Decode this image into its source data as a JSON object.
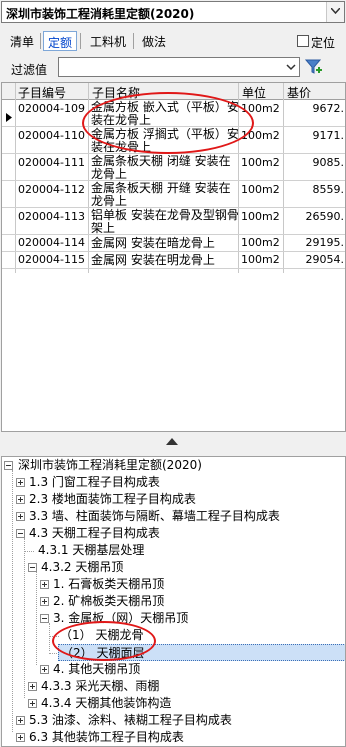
{
  "selector": {
    "value": "深圳市装饰工程消耗里定额(2020)"
  },
  "tabs": {
    "list": "清单",
    "quota": "定额",
    "labor": "工料机",
    "method": "做法",
    "locate": "定位"
  },
  "filter": {
    "label": "过滤值",
    "value": ""
  },
  "table": {
    "headers": {
      "code": "子目编号",
      "name": "子目名称",
      "unit": "单位",
      "price": "基价"
    },
    "rows": [
      {
        "code": "020004-109",
        "name": "金属方板 嵌入式（平板）安装在龙骨上",
        "unit": "100m2",
        "price": "9672."
      },
      {
        "code": "020004-110",
        "name": "金属方板 浮搁式（平板）安装在龙骨上",
        "unit": "100m2",
        "price": "9171."
      },
      {
        "code": "020004-111",
        "name": "金属条板天棚 闭缝 安装在龙骨上",
        "unit": "100m2",
        "price": "9085."
      },
      {
        "code": "020004-112",
        "name": "金属条板天棚 开缝 安装在龙骨上",
        "unit": "100m2",
        "price": "8559."
      },
      {
        "code": "020004-113",
        "name": "铝单板 安装在龙骨及型钢骨架上",
        "unit": "100m2",
        "price": "26590."
      },
      {
        "code": "020004-114",
        "name": "金属网 安装在暗龙骨上",
        "unit": "100m2",
        "price": "29195."
      },
      {
        "code": "020004-115",
        "name": "金属网 安装在明龙骨上",
        "unit": "100m2",
        "price": "29054."
      }
    ]
  },
  "tree": {
    "root": "深圳市装饰工程消耗里定额(2020)",
    "items": [
      "1.3 门窗工程子目构成表",
      "2.3 楼地面装饰工程子目构成表",
      "3.3 墙、柱面装饰与隔断、幕墙工程子目构成表",
      "4.3 天棚工程子目构成表",
      "4.3.1 天棚基层处理",
      "4.3.2 天棚吊顶",
      "1. 石膏板类天棚吊顶",
      "2. 矿棉板类天棚吊顶",
      "3. 金属板（网）天棚吊顶",
      "（1） 天棚龙骨",
      "（2） 天棚面层",
      "4. 其他天棚吊顶",
      "4.3.3 采光天棚、雨棚",
      "4.3.4 天棚其他装饰构造",
      "5.3 油漆、涂料、裱糊工程子目构成表",
      "6.3 其他装饰工程子目构成表"
    ]
  },
  "colors": {
    "annotation": "#e01818",
    "active_tab": "#0044cc",
    "selected_bg": "#cce0f7"
  }
}
